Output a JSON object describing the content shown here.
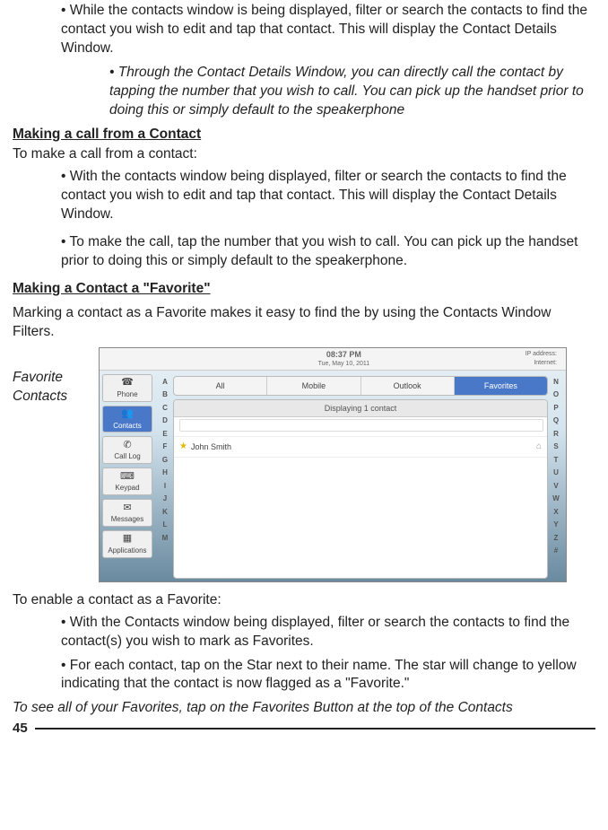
{
  "bullets": {
    "b1": "• While the contacts window is being displayed, filter or search the contacts to find the contact you wish to edit and tap that contact. This will display the Contact Details Window.",
    "b1a": "• Through the Contact Details Window, you can directly call the contact by tapping the number that you wish to call. You can pick up the handset prior to doing this or simply default to the speakerphone"
  },
  "heading1": "Making a call from a Contact",
  "para1": "To make a call from a contact:",
  "call_bullets": {
    "b1": "• With the contacts window being displayed, filter or search the contacts to find the contact you wish to edit and tap that contact. This will display the Contact Details Window.",
    "b2": "• To make the call, tap the number that you wish to call. You can pick up the handset prior to doing this or simply default to the speakerphone."
  },
  "heading2": "Making a Contact a \"Favorite\" ",
  "para2": "Marking a contact as a Favorite makes it easy to find the by using the Contacts Window Filters.",
  "fig_label": "Favorite Contacts",
  "screenshot": {
    "time": "08:37 PM",
    "date": "Tue, May 10, 2011",
    "ip_label": "IP address:",
    "ip_status": "Internet:",
    "sidebar": [
      {
        "label": "Phone"
      },
      {
        "label": "Contacts"
      },
      {
        "label": "Call Log"
      },
      {
        "label": "Keypad"
      },
      {
        "label": "Messages"
      },
      {
        "label": "Applications"
      }
    ],
    "tabs": [
      "All",
      "Mobile",
      "Outlook",
      "Favorites"
    ],
    "list_header": "Displaying 1 contact",
    "contact_name": "John Smith",
    "left_letters": [
      "A",
      "B",
      "C",
      "D",
      "E",
      "F",
      "G",
      "H",
      "I",
      "J",
      "K",
      "L",
      "M"
    ],
    "right_letters": [
      "N",
      "O",
      "P",
      "Q",
      "R",
      "S",
      "T",
      "U",
      "V",
      "W",
      "X",
      "Y",
      "Z",
      "#"
    ]
  },
  "para3": "To enable a contact as a Favorite:",
  "enable_bullets": {
    "b1": "• With the Contacts window being displayed, filter or search the contacts to find the contact(s) you wish to mark as Favorites.",
    "b2": "• For each contact, tap on the Star next to their name. The star will change to yellow indicating that the contact is now flagged as a \"Favorite.\""
  },
  "note": "To see all of your Favorites, tap on the Favorites Button at the top of the Contacts",
  "page_number": "45"
}
